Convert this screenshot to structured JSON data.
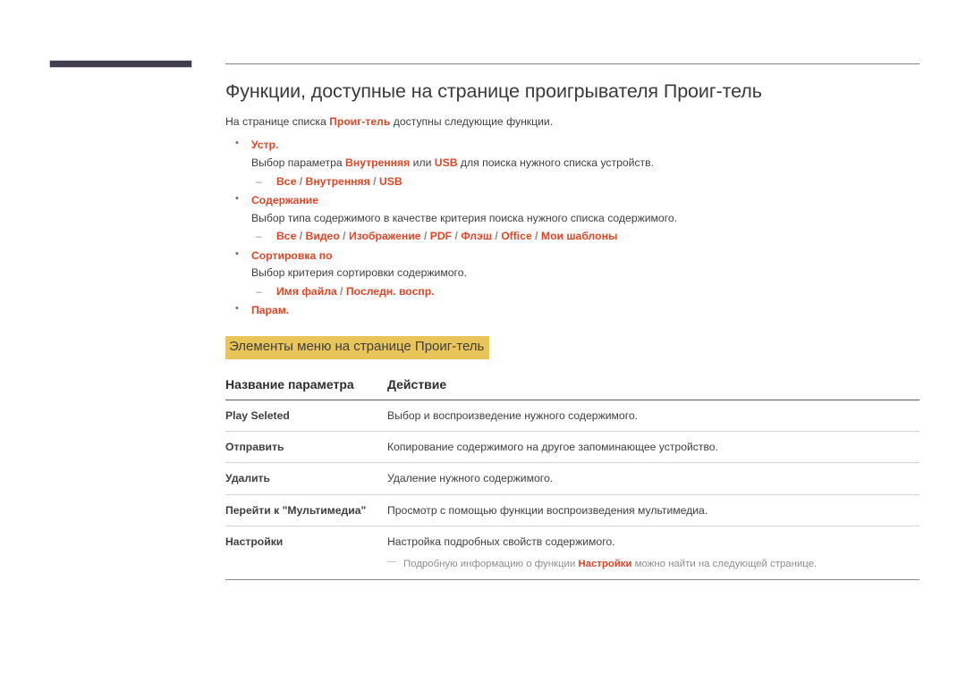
{
  "document": {
    "title": "Функции, доступные на странице проигрывателя Проиг-тель",
    "intro_prefix": "На странице списка ",
    "intro_accent": "Проиг-тель",
    "intro_suffix": " доступны следующие функции."
  },
  "features": [
    {
      "label": "Устр.",
      "description_prefix": "Выбор параметра ",
      "description_accent_1": "Внутренняя",
      "description_mid": " или ",
      "description_accent_2": "USB",
      "description_suffix": " для поиска нужного списка устройств.",
      "options": [
        "Все",
        "Внутренняя",
        "USB"
      ]
    },
    {
      "label": "Содержание",
      "description": "Выбор типа содержимого в качестве критерия поиска нужного списка содержимого.",
      "options": [
        "Все",
        "Видео",
        "Изображение",
        "PDF",
        "Флэш",
        "Office",
        "Мои шаблоны"
      ]
    },
    {
      "label": "Сортировка по",
      "description": "Выбор критерия сортировки содержимого.",
      "options": [
        "Имя файла",
        "Последн. воспр."
      ]
    },
    {
      "label": "Парам.",
      "description": "",
      "options": []
    }
  ],
  "section": {
    "heading": "Элементы меню на странице Проиг-тель"
  },
  "table": {
    "headers": [
      "Название параметра",
      "Действие"
    ],
    "rows": [
      {
        "name": "Play Seleted",
        "action": "Выбор и воспроизведение нужного содержимого."
      },
      {
        "name": "Отправить",
        "action": "Копирование содержимого на другое запоминающее устройство."
      },
      {
        "name": "Удалить",
        "action": "Удаление нужного содержимого."
      },
      {
        "name": "Перейти к \"Мультимедиа\"",
        "action": "Просмотр с помощью функции воспроизведения мультимедиа."
      },
      {
        "name": "Настройки",
        "action": "Настройка подробных свойств содержимого."
      }
    ],
    "note": {
      "prefix": "Подробную информацию о функции ",
      "accent": "Настройки",
      "suffix": " можно найти на следующей странице."
    }
  },
  "colors": {
    "accent": "#e04626",
    "highlight": "#e9c559",
    "corner_bar": "#433d50",
    "text": "#404040"
  },
  "separator": "/"
}
